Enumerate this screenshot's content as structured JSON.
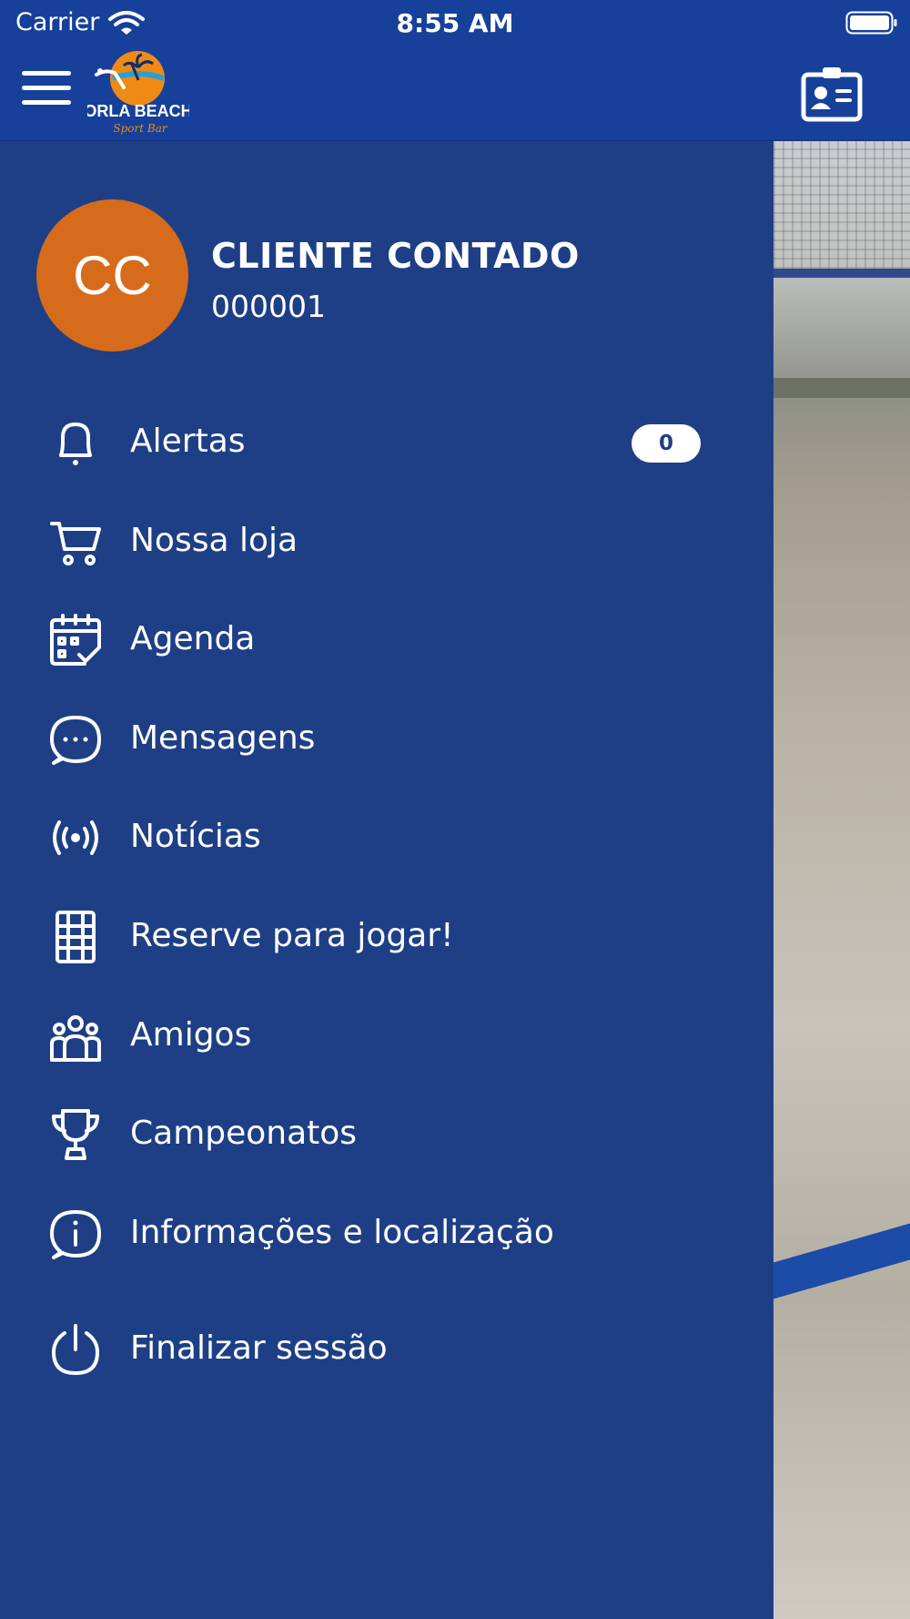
{
  "status_bar": {
    "carrier": "Carrier",
    "time": "8:55 AM",
    "icons": [
      "wifi-icon",
      "battery-icon"
    ]
  },
  "header": {
    "menu_icon": "hamburger-menu-icon",
    "logo": {
      "line1": "ORLA BEACH",
      "line2": "Sport Bar"
    },
    "card_icon": "contact-card-icon"
  },
  "drawer": {
    "user": {
      "initials": "CC",
      "name": "CLIENTE CONTADO",
      "id": "000001"
    },
    "items": [
      {
        "label": "Alertas",
        "icon": "bell-icon",
        "badge": "0"
      },
      {
        "label": "Nossa loja",
        "icon": "cart-icon"
      },
      {
        "label": "Agenda",
        "icon": "calendar-check-icon"
      },
      {
        "label": "Mensagens",
        "icon": "chat-bubble-icon"
      },
      {
        "label": "Notícias",
        "icon": "broadcast-icon"
      },
      {
        "label": "Reserve para jogar!",
        "icon": "court-icon"
      },
      {
        "label": "Amigos",
        "icon": "friends-icon"
      },
      {
        "label": "Campeonatos",
        "icon": "trophy-icon"
      },
      {
        "label": "Informações e localização",
        "icon": "info-bubble-icon"
      },
      {
        "label": "Finalizar sessão",
        "icon": "power-icon"
      }
    ]
  },
  "colors": {
    "header": "#17409a",
    "drawer": "#1e3f86",
    "avatar": "#d66b1b",
    "text": "#ffffff"
  }
}
